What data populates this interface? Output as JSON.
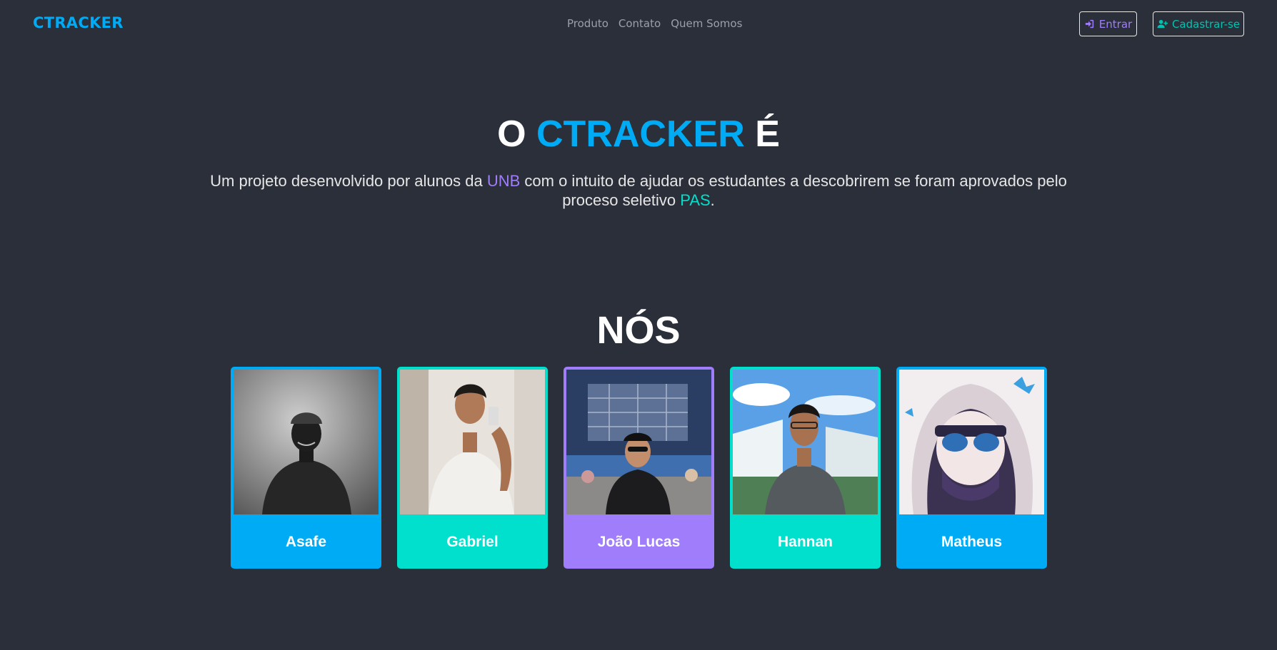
{
  "colors": {
    "background": "#2b2f3a",
    "blue": "#00abf5",
    "teal": "#00e0cc",
    "purple": "#a07dfa",
    "muted": "#9aa0ab"
  },
  "navbar": {
    "brand": "CTRACKER",
    "links": [
      "Produto",
      "Contato",
      "Quem Somos"
    ],
    "login_label": "Entrar",
    "login_icon": "sign-in-icon",
    "signup_label": "Cadastrar-se",
    "signup_icon": "user-plus-icon"
  },
  "hero": {
    "title_prefix": "O",
    "title_highlight": "CTRACKER",
    "title_suffix": "É",
    "subtitle_1": "Um projeto desenvolvido por alunos da ",
    "subtitle_unb": "UNB",
    "subtitle_2": " com o intuito de ajudar os estudantes a descobrirem se foram aprovados pelo proceso seletivo ",
    "subtitle_pas": "PAS",
    "subtitle_3": "."
  },
  "team": {
    "title": "NÓS",
    "members": [
      {
        "name": "Asafe",
        "color": "#00abf5"
      },
      {
        "name": "Gabriel",
        "color": "#00e0cc"
      },
      {
        "name": "João Lucas",
        "color": "#a07dfa"
      },
      {
        "name": "Hannan",
        "color": "#00e0cc"
      },
      {
        "name": "Matheus",
        "color": "#00abf5"
      }
    ]
  }
}
